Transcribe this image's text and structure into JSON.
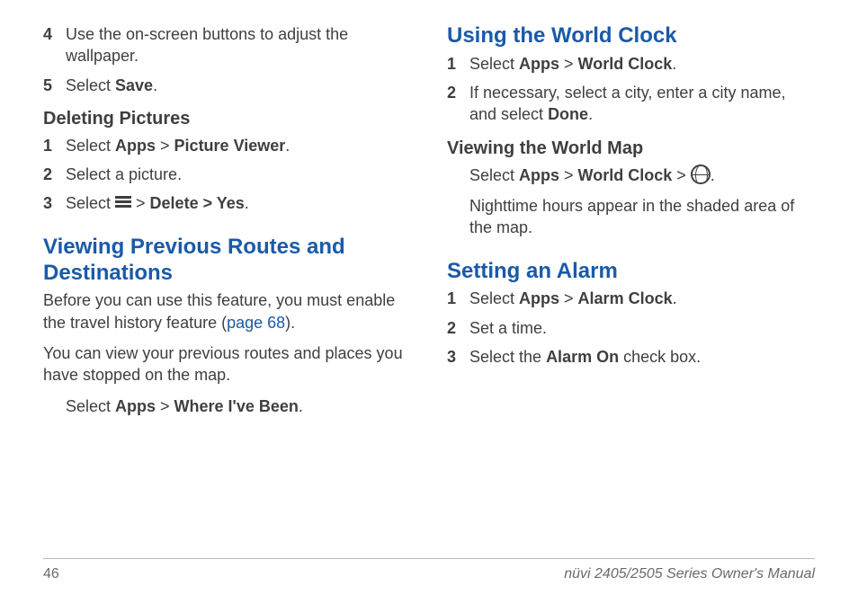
{
  "left": {
    "step4": {
      "num": "4",
      "text_a": "Use the on-screen buttons to adjust the wallpaper."
    },
    "step5": {
      "num": "5",
      "text_a": "Select ",
      "bold_a": "Save",
      "text_b": "."
    },
    "deleting_heading": "Deleting Pictures",
    "del1": {
      "num": "1",
      "a": "Select ",
      "b": "Apps",
      "c": " > ",
      "d": "Picture Viewer",
      "e": "."
    },
    "del2": {
      "num": "2",
      "a": "Select a picture."
    },
    "del3": {
      "num": "3",
      "a": "Select ",
      "b": " > ",
      "c": "Delete > Yes",
      "d": "."
    },
    "prev_heading": "Viewing Previous Routes and Destinations",
    "prev_p1a": "Before you can use this feature, you must enable the travel history feature (",
    "prev_link": "page 68",
    "prev_p1b": ").",
    "prev_p2": "You can view your previous routes and places you have stopped on the map.",
    "prev_p3a": "Select ",
    "prev_p3b": "Apps",
    "prev_p3c": " > ",
    "prev_p3d": "Where I've Been",
    "prev_p3e": "."
  },
  "right": {
    "world_heading": "Using the World Clock",
    "w1": {
      "num": "1",
      "a": "Select ",
      "b": "Apps",
      "c": " > ",
      "d": "World Clock",
      "e": "."
    },
    "w2": {
      "num": "2",
      "a": "If necessary, select a city, enter a city name, and select ",
      "b": "Done",
      "c": "."
    },
    "map_heading": "Viewing the World Map",
    "map_p1a": "Select ",
    "map_p1b": "Apps",
    "map_p1c": " > ",
    "map_p1d": "World Clock",
    "map_p1e": " > ",
    "map_p1f": ".",
    "map_p2": "Nighttime hours appear in the shaded area of the map.",
    "alarm_heading": "Setting an Alarm",
    "a1": {
      "num": "1",
      "a": "Select ",
      "b": "Apps",
      "c": " > ",
      "d": "Alarm Clock",
      "e": "."
    },
    "a2": {
      "num": "2",
      "a": "Set a time."
    },
    "a3": {
      "num": "3",
      "a": "Select the ",
      "b": "Alarm On",
      "c": " check box."
    }
  },
  "footer": {
    "page": "46",
    "title": "nüvi 2405/2505 Series Owner's Manual"
  }
}
